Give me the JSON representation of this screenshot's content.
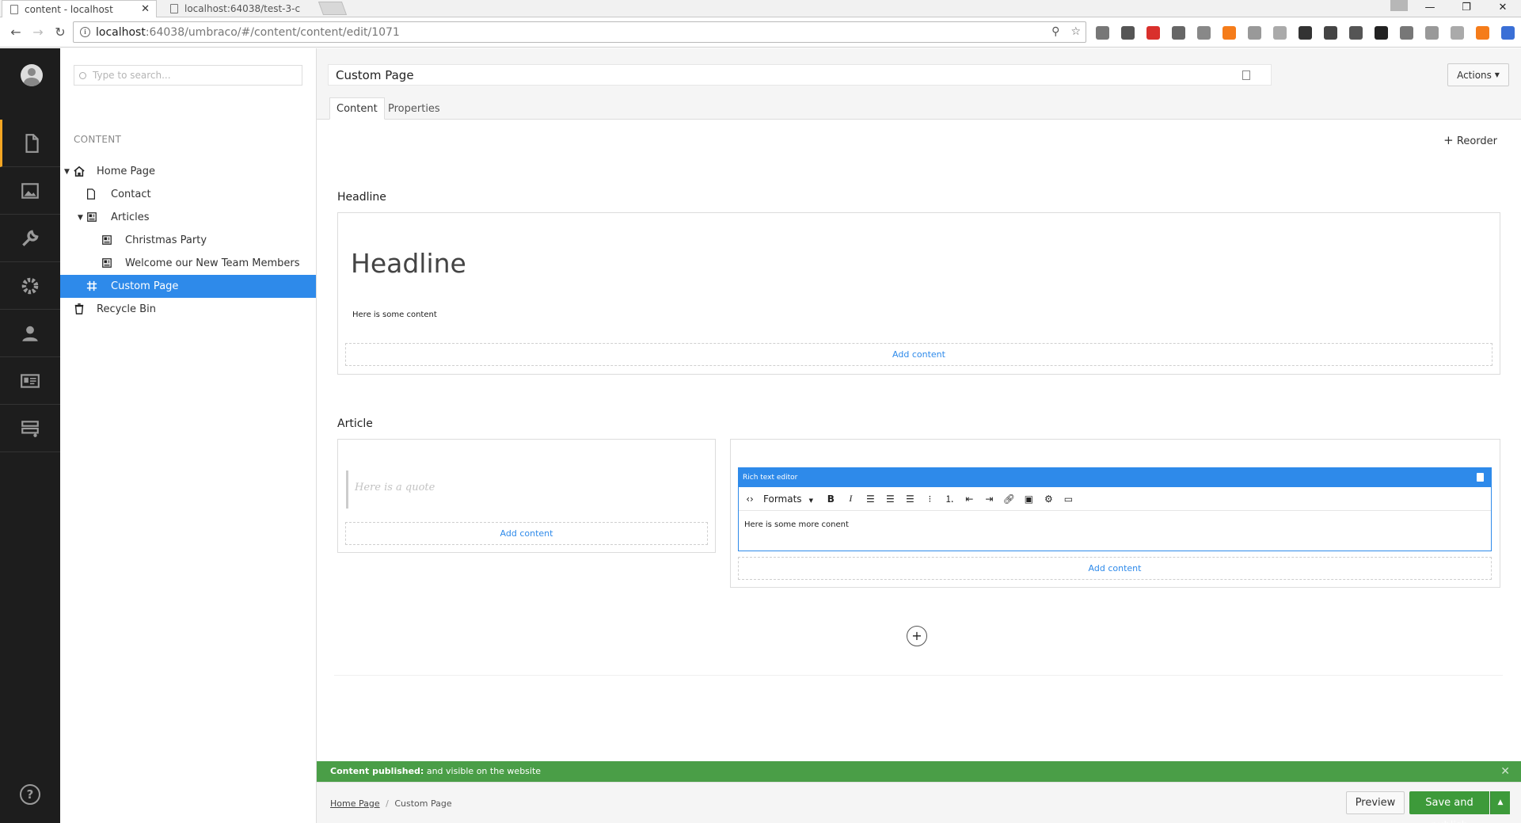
{
  "browser": {
    "tabs": [
      {
        "title": "content - localhost",
        "close": "✕"
      },
      {
        "title": "localhost:64038/test-3-c"
      }
    ],
    "url_host": "localhost",
    "url_path": ":64038/umbraco/#/content/content/edit/1071",
    "window_controls": {
      "minimize": "—",
      "maximize": "❐",
      "close": "✕"
    },
    "extension_colors": [
      "#777",
      "#555",
      "#d9302c",
      "#666",
      "#888",
      "#f57c1a",
      "#999",
      "#aaa",
      "#333",
      "#444",
      "#555",
      "#222",
      "#777",
      "#999",
      "#aaa",
      "#f57c1a",
      "#3a6fd6",
      "#f1a100"
    ]
  },
  "sidebar": {
    "sections": [
      {
        "name": "content",
        "icon": "document-icon"
      },
      {
        "name": "media",
        "icon": "image-icon"
      },
      {
        "name": "developer",
        "icon": "wrench-icon"
      },
      {
        "name": "settings",
        "icon": "gear-icon"
      },
      {
        "name": "users",
        "icon": "user-icon"
      },
      {
        "name": "members",
        "icon": "id-card-icon"
      },
      {
        "name": "forms",
        "icon": "forms-icon"
      }
    ],
    "help": "?"
  },
  "tree": {
    "search_placeholder": "Type to search...",
    "title": "CONTENT",
    "nodes": [
      {
        "label": "Home Page"
      },
      {
        "label": "Contact"
      },
      {
        "label": "Articles"
      },
      {
        "label": "Christmas Party"
      },
      {
        "label": "Welcome our New Team Members"
      },
      {
        "label": "Custom Page"
      },
      {
        "label": "Recycle Bin"
      }
    ]
  },
  "editor": {
    "name": "Custom Page",
    "actions_label": "Actions",
    "tabs": [
      {
        "label": "Content"
      },
      {
        "label": "Properties"
      }
    ],
    "reorder_label": "Reorder",
    "sections": [
      {
        "label": "Headline",
        "headline": "Headline",
        "body": "Here is some content",
        "add_content": "Add content"
      },
      {
        "label": "Article",
        "quote_placeholder": "Here is a quote",
        "add_content_left": "Add content",
        "rte_title": "Rich text editor",
        "formats_label": "Formats",
        "rte_body": "Here is some more conent",
        "add_content_right": "Add content"
      }
    ],
    "add_row": "+"
  },
  "notification": {
    "strong": "Content published:",
    "text": " and visible on the website",
    "close": "✕"
  },
  "footer": {
    "breadcrumb_root": "Home Page",
    "breadcrumb_sep": "/",
    "breadcrumb_current": "Custom Page",
    "preview_label": "Preview",
    "publish_label": "Save and publish",
    "accent_green": "#3d9a3a",
    "accent_blue": "#2e8aea"
  }
}
